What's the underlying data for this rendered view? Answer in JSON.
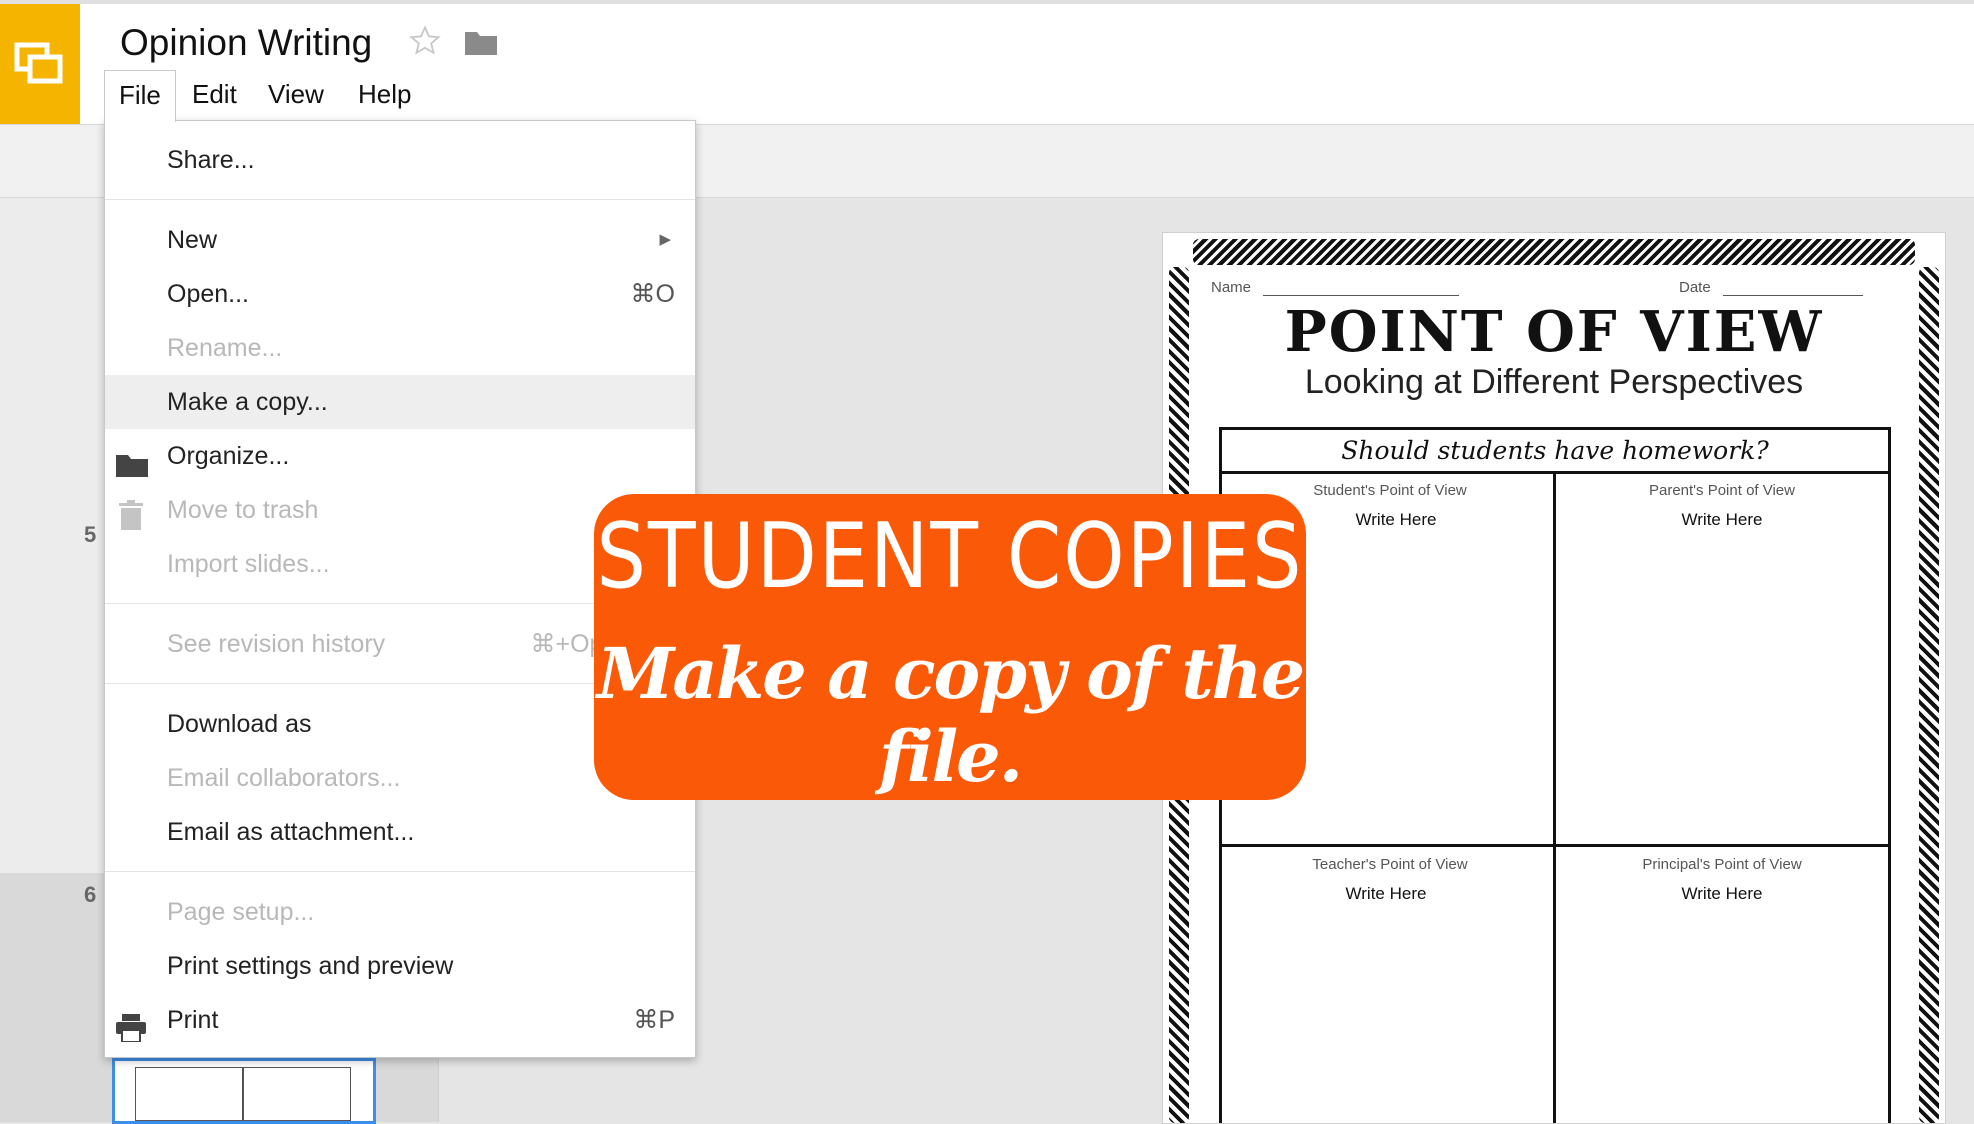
{
  "app": {
    "title": "Opinion Writing",
    "menubar": [
      "File",
      "Edit",
      "View",
      "Help"
    ],
    "brand_color": "#f4b400"
  },
  "file_menu": {
    "items": [
      {
        "label": "Share...",
        "shortcut": "",
        "disabled": false,
        "icon": ""
      },
      {
        "label": "New",
        "shortcut": "",
        "disabled": false,
        "submenu": true
      },
      {
        "label": "Open...",
        "shortcut": "⌘O",
        "disabled": false
      },
      {
        "label": "Rename...",
        "shortcut": "",
        "disabled": true
      },
      {
        "label": "Make a copy...",
        "shortcut": "",
        "disabled": false,
        "hovered": true
      },
      {
        "label": "Organize...",
        "shortcut": "",
        "disabled": false,
        "icon": "folder-icon"
      },
      {
        "label": "Move to trash",
        "shortcut": "",
        "disabled": true,
        "icon": "trash-icon"
      },
      {
        "label": "Import slides...",
        "shortcut": "",
        "disabled": true
      },
      {
        "label": "See revision history",
        "shortcut": "⌘+Option+S",
        "disabled": true
      },
      {
        "label": "Download as",
        "shortcut": "",
        "disabled": false
      },
      {
        "label": "Email collaborators...",
        "shortcut": "",
        "disabled": true
      },
      {
        "label": "Email as attachment...",
        "shortcut": "",
        "disabled": false
      },
      {
        "label": "Page setup...",
        "shortcut": "",
        "disabled": true
      },
      {
        "label": "Print settings and preview",
        "shortcut": "",
        "disabled": false
      },
      {
        "label": "Print",
        "shortcut": "⌘P",
        "disabled": false,
        "icon": "printer-icon"
      }
    ]
  },
  "filmstrip": {
    "slide_numbers": [
      "5",
      "6"
    ]
  },
  "worksheet": {
    "name_label": "Name",
    "date_label": "Date",
    "title": "POINT OF VIEW",
    "subtitle": "Looking at Different Perspectives",
    "question": "Should students have homework?",
    "cells": [
      {
        "label": "Student's Point of View",
        "write": "Write Here"
      },
      {
        "label": "Parent's Point of View",
        "write": "Write Here"
      },
      {
        "label": "Teacher's Point of View",
        "write": "Write Here"
      },
      {
        "label": "Principal's Point of View",
        "write": "Write Here"
      }
    ]
  },
  "overlay": {
    "line1": "STUDENT COPIES",
    "line2": "Make a copy of the file.",
    "color": "#fa5a08"
  }
}
